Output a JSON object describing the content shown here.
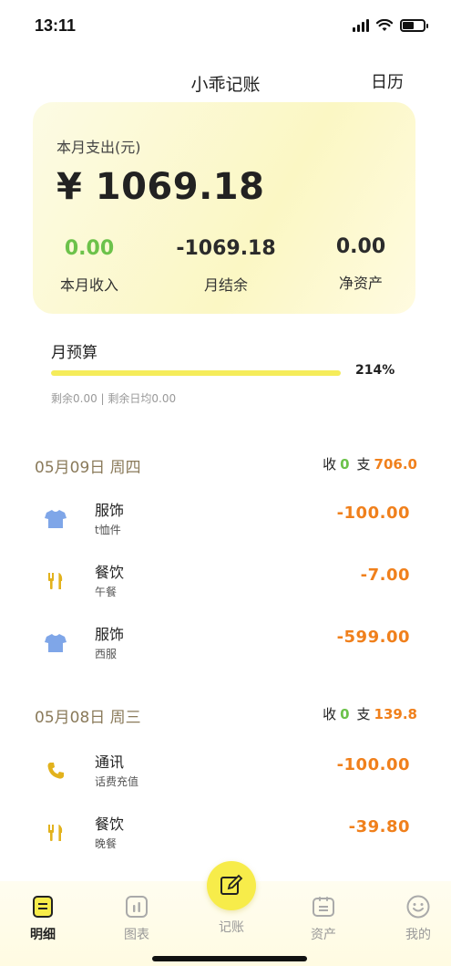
{
  "status": {
    "time": "13:11"
  },
  "nav": {
    "title": "小乖记账",
    "calendar": "日历"
  },
  "summary": {
    "label": "本月支出(元)",
    "amount": "¥ 1069.18",
    "income_value": "0.00",
    "income_label": "本月收入",
    "balance_value": "-1069.18",
    "balance_label": "月结余",
    "net_value": "0.00",
    "net_label": "净资产"
  },
  "budget": {
    "title": "月预算",
    "percent": "214%",
    "fill_fraction": 1.0,
    "note": "剩余0.00 | 剩余日均0.00"
  },
  "days": [
    {
      "date": "05月09日  周四",
      "income_label": "收",
      "income": "0",
      "expense_label": "支",
      "expense": "706.0",
      "items": [
        {
          "icon": "shirt-icon",
          "category": "服饰",
          "note": "t恤件",
          "amount": "-100.00"
        },
        {
          "icon": "fork-knife-icon",
          "category": "餐饮",
          "note": "午餐",
          "amount": "-7.00"
        },
        {
          "icon": "shirt-icon",
          "category": "服饰",
          "note": "西服",
          "amount": "-599.00"
        }
      ]
    },
    {
      "date": "05月08日  周三",
      "income_label": "收",
      "income": "0",
      "expense_label": "支",
      "expense": "139.8",
      "items": [
        {
          "icon": "phone-icon",
          "category": "通讯",
          "note": "话费充值",
          "amount": "-100.00"
        },
        {
          "icon": "fork-knife-icon",
          "category": "餐饮",
          "note": "晚餐",
          "amount": "-39.80"
        }
      ]
    }
  ],
  "tabs": [
    {
      "label": "明细",
      "icon": "list-icon",
      "active": true
    },
    {
      "label": "图表",
      "icon": "chart-icon",
      "active": false
    },
    {
      "label": "记账",
      "icon": "edit-icon",
      "active": false
    },
    {
      "label": "资产",
      "icon": "wallet-icon",
      "active": false
    },
    {
      "label": "我的",
      "icon": "smile-icon",
      "active": false
    }
  ],
  "colors": {
    "accent": "#f7ec4a",
    "expense": "#f0801c",
    "income": "#6cc24a",
    "shirt": "#7fa6e8",
    "food": "#e2b21d",
    "phone": "#e2b21d"
  }
}
